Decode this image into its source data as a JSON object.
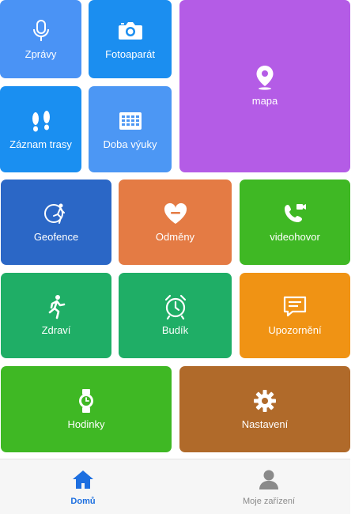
{
  "tiles": {
    "zpravy": {
      "label": "Zprávy",
      "color": "#4a93f5",
      "icon": "microphone-icon"
    },
    "fotoaparat": {
      "label": "Fotoaparát",
      "color": "#1b8ef0",
      "icon": "camera-icon"
    },
    "mapa": {
      "label": "mapa",
      "color": "#b45ce6",
      "icon": "map-pin-icon"
    },
    "zaznam": {
      "label": "Záznam trasy",
      "color": "#1a8ff1",
      "icon": "footprints-icon"
    },
    "doba": {
      "label": "Doba výuky",
      "color": "#4c97f4",
      "icon": "calendar-grid-icon"
    },
    "geofence": {
      "label": "Geofence",
      "color": "#2b67c6",
      "icon": "geofence-runner-icon"
    },
    "odmeny": {
      "label": "Odměny",
      "color": "#e47b44",
      "icon": "heart-icon"
    },
    "video": {
      "label": "videohovor",
      "color": "#3fb824",
      "icon": "video-call-icon"
    },
    "zdravi": {
      "label": "Zdraví",
      "color": "#1fae66",
      "icon": "runner-icon"
    },
    "budik": {
      "label": "Budík",
      "color": "#1fae66",
      "icon": "alarm-clock-icon"
    },
    "upozorneni": {
      "label": "Upozornění",
      "color": "#f09314",
      "icon": "message-icon"
    },
    "hodinky": {
      "label": "Hodinky",
      "color": "#3fb824",
      "icon": "watch-icon"
    },
    "nastaveni": {
      "label": "Nastavení",
      "color": "#b06a2a",
      "icon": "gear-icon"
    }
  },
  "tabbar": {
    "home": {
      "label": "Domů",
      "icon": "home-icon",
      "color": "#1d6fe0"
    },
    "devices": {
      "label": "Moje zařízení",
      "icon": "person-icon",
      "color": "#8a8a8a"
    }
  }
}
